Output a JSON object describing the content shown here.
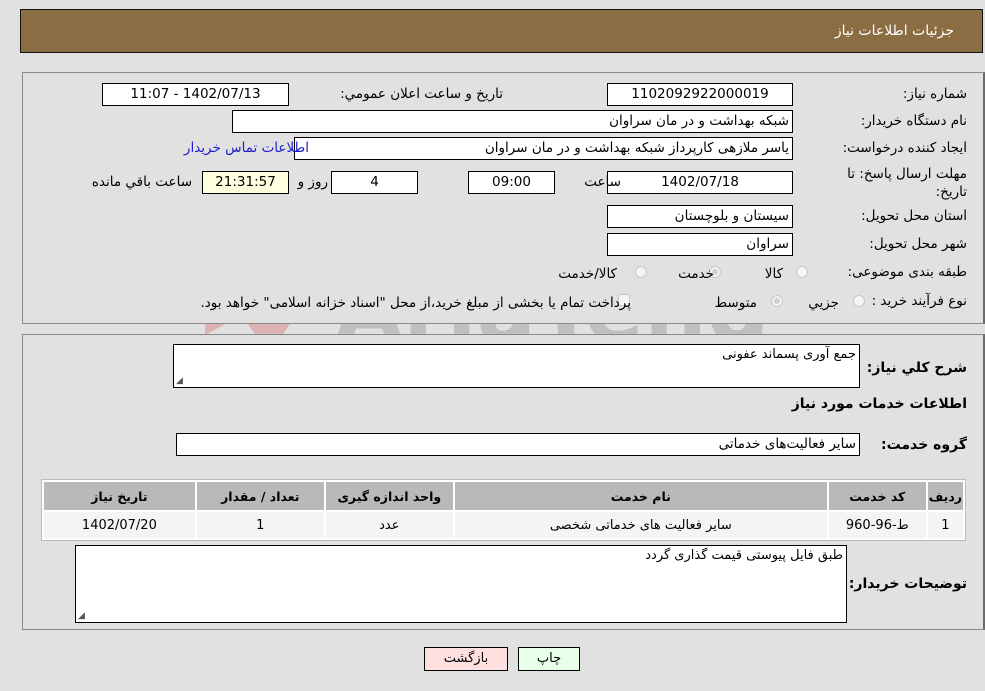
{
  "header": {
    "title": "جزئيات اطلاعات نياز"
  },
  "info": {
    "need_number_label": "شماره نياز:",
    "need_number": "1102092922000019",
    "announce_label": "تاريخ و ساعت اعلان عمومي:",
    "announce_value": "1402/07/13 - 11:07",
    "buyer_org_label": "نام دستگاه خريدار:",
    "buyer_org": "شبکه بهداشت و در مان سراوان",
    "creator_label": "ايجاد کننده درخواست:",
    "creator": "یاسر ملازهی کارپرداز شبکه بهداشت و در مان سراوان",
    "contact_link": "اطلاعات تماس خريدار",
    "deadline_label": "مهلت ارسال پاسخ: تا تاريخ:",
    "deadline_date": "1402/07/18",
    "time_label": "ساعت",
    "deadline_time": "09:00",
    "days": "4",
    "days_label": "روز و",
    "remaining": "21:31:57",
    "remaining_label": "ساعت باقي مانده",
    "province_label": "استان محل تحويل:",
    "province": "سيستان و بلوچستان",
    "city_label": "شهر محل تحويل:",
    "city": "سراوان",
    "category_label": "طبقه بندی موضوعی:",
    "category_options": [
      "کالا",
      "خدمت",
      "کالا/خدمت"
    ],
    "category_selected": "خدمت",
    "process_label": "نوع فرآيند خريد :",
    "process_options": [
      "جزيي",
      "متوسط"
    ],
    "process_selected": "متوسط",
    "treasury_note": "پرداخت تمام يا بخشی از مبلغ خريد،از محل \"اسناد خزانه اسلامی\" خواهد بود."
  },
  "details": {
    "summary_label": "شرح کلي نياز:",
    "summary": "جمع آوری پسماند عفونی",
    "services_heading": "اطلاعات خدمات مورد نياز",
    "service_group_label": "گروه خدمت:",
    "service_group": "ساير فعاليت‌هاى خدماتى",
    "table": {
      "headers": [
        "رديف",
        "کد خدمت",
        "نام خدمت",
        "واحد اندازه گيری",
        "تعداد / مقدار",
        "تاريخ نياز"
      ],
      "rows": [
        [
          "1",
          "ط-96-960",
          "ساير فعاليت های خدماتی شخصی",
          "عدد",
          "1",
          "1402/07/20"
        ]
      ]
    },
    "buyer_notes_label": "توضيحات خريدار:",
    "buyer_notes": "طبق فایل پیوستی قیمت گذاری گردد"
  },
  "buttons": {
    "print": "چاپ",
    "back": "بازگشت"
  },
  "colors": {
    "header": "#8b6d43",
    "back_button": "#ffe0e0",
    "print_button": "#e8ffe8",
    "remaining_box": "#ffffe0",
    "link": "#1a1acc"
  }
}
